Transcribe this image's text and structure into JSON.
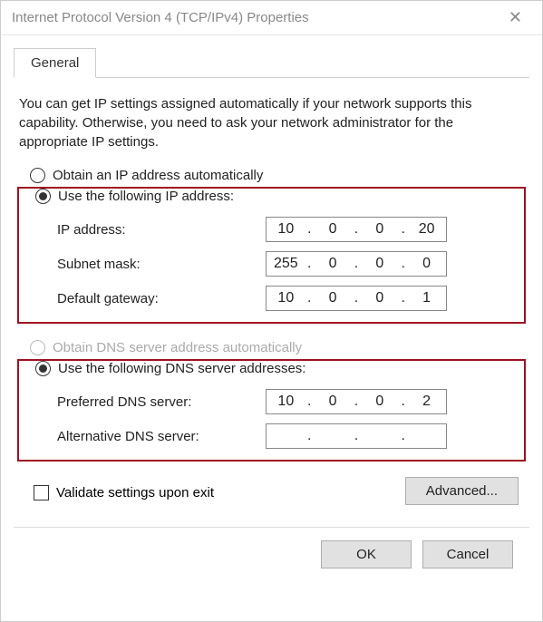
{
  "window": {
    "title": "Internet Protocol Version 4 (TCP/IPv4) Properties"
  },
  "tab": {
    "general": "General"
  },
  "description": "You can get IP settings assigned automatically if your network supports this capability. Otherwise, you need to ask your network administrator for the appropriate IP settings.",
  "ip": {
    "obtain_auto": "Obtain an IP address automatically",
    "use_following": "Use the following IP address:",
    "address_label": "IP address:",
    "address": {
      "a": "10",
      "b": "0",
      "c": "0",
      "d": "20"
    },
    "subnet_label": "Subnet mask:",
    "subnet": {
      "a": "255",
      "b": "0",
      "c": "0",
      "d": "0"
    },
    "gateway_label": "Default gateway:",
    "gateway": {
      "a": "10",
      "b": "0",
      "c": "0",
      "d": "1"
    }
  },
  "dns": {
    "obtain_auto": "Obtain DNS server address automatically",
    "use_following": "Use the following DNS server addresses:",
    "preferred_label": "Preferred DNS server:",
    "preferred": {
      "a": "10",
      "b": "0",
      "c": "0",
      "d": "2"
    },
    "alt_label": "Alternative DNS server:",
    "alt": {
      "a": "",
      "b": "",
      "c": "",
      "d": ""
    }
  },
  "validate_label": "Validate settings upon exit",
  "buttons": {
    "advanced": "Advanced...",
    "ok": "OK",
    "cancel": "Cancel"
  }
}
